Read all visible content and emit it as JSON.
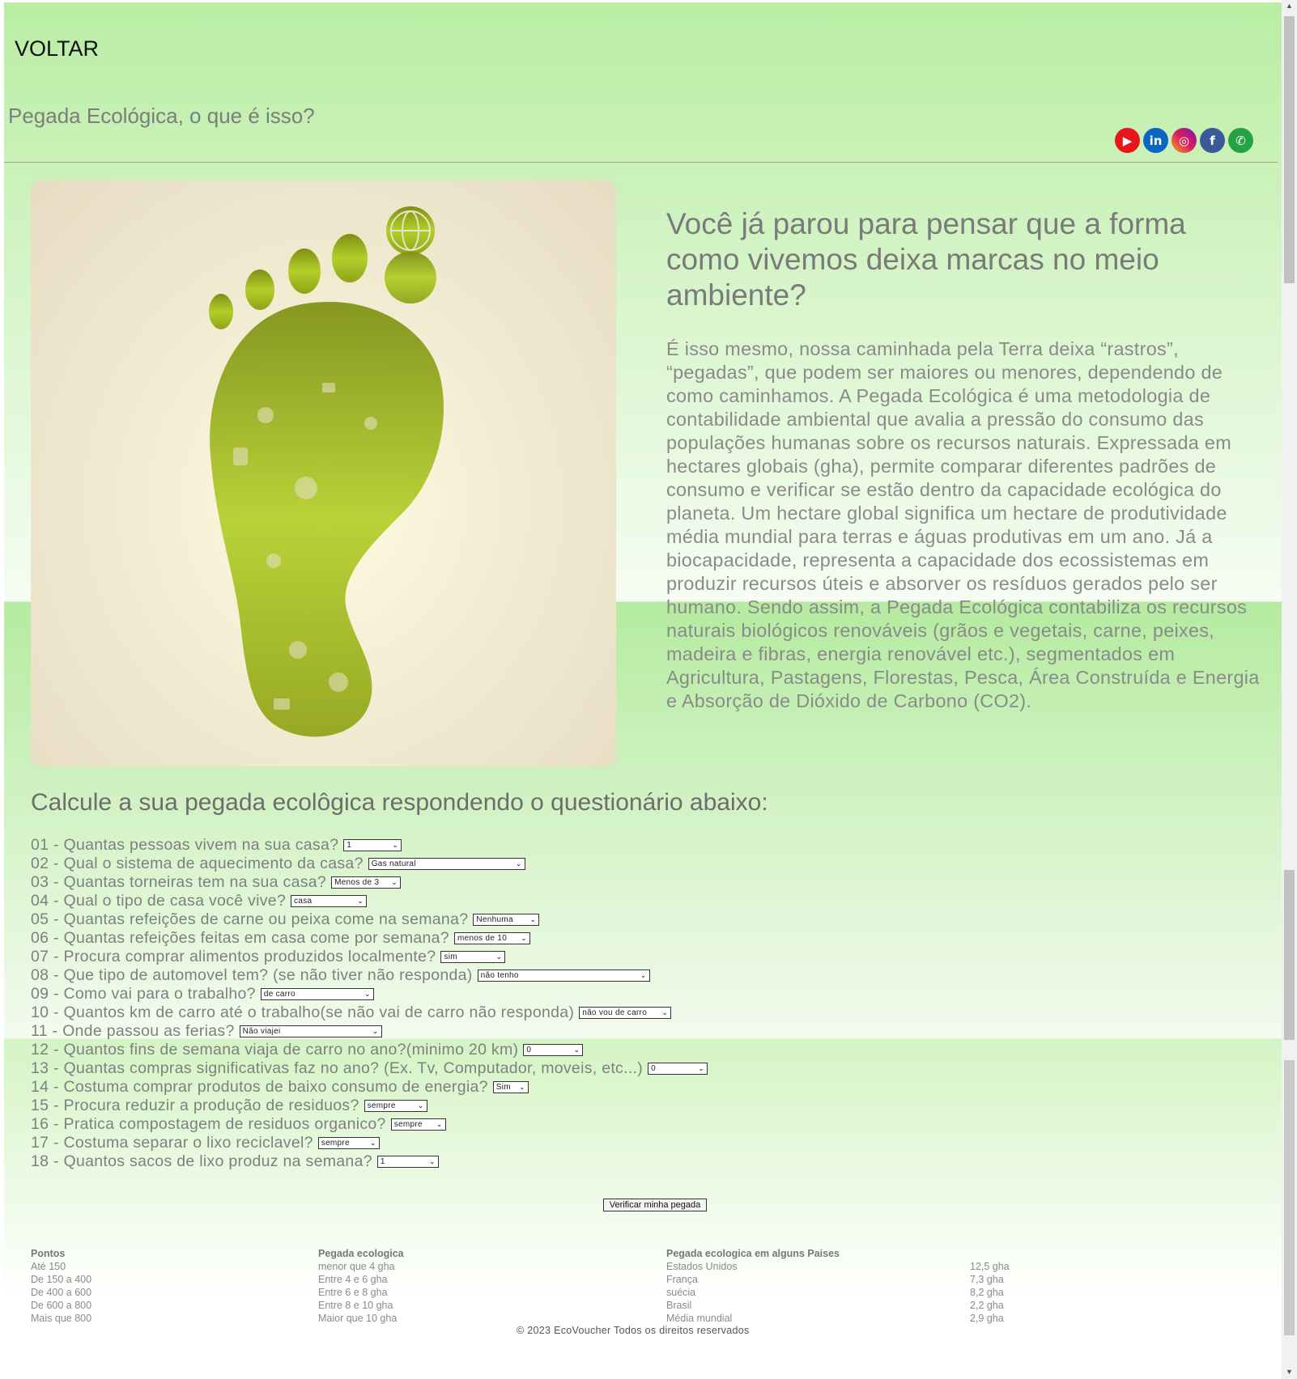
{
  "nav": {
    "back_label": "VOLTAR"
  },
  "header": {
    "title": "Pegada Ecológica, o que é isso?",
    "social": [
      {
        "name": "youtube-icon",
        "glyph": "▶"
      },
      {
        "name": "linkedin-icon",
        "glyph": "in"
      },
      {
        "name": "instagram-icon",
        "glyph": "◎"
      },
      {
        "name": "facebook-icon",
        "glyph": "f"
      },
      {
        "name": "whatsapp-icon",
        "glyph": "✆"
      }
    ]
  },
  "hero": {
    "heading": "Você já parou para pensar que a forma como vivemos deixa marcas no meio ambiente?",
    "text": "É isso mesmo, nossa caminhada pela Terra deixa “rastros”, “pegadas”, que podem ser maiores ou menores, dependendo de como caminhamos. A Pegada Ecológica é uma metodologia de contabilidade ambiental que avalia a pressão do consumo das populações humanas sobre os recursos naturais. Expressada em hectares globais (gha), permite comparar diferentes padrões de consumo e verificar se estão dentro da capacidade ecológica do planeta. Um hectare global significa um hectare de produtividade média mundial para terras e águas produtivas em um ano. Já a biocapacidade, representa a capacidade dos ecossistemas em produzir recursos úteis e absorver os resíduos gerados pelo ser humano. Sendo assim, a Pegada Ecológica contabiliza os recursos naturais biológicos renováveis (grãos e vegetais, carne, peixes, madeira e fibras, energia renovável etc.), segmentados em Agricultura, Pastagens, Florestas, Pesca, Área Construída e Energia e Absorção de Dióxido de Carbono (CO2)."
  },
  "quiz": {
    "heading": "Calcule a sua pegada ecolôgica respondendo o questionário abaixo:",
    "questions": [
      {
        "label": "01 - Quantas pessoas vivem na sua casa?",
        "value": "1",
        "w": 64
      },
      {
        "label": "02 - Qual o sistema de aquecimento da casa?",
        "value": "Gas natural",
        "w": 186
      },
      {
        "label": "03 - Quantas torneiras tem na sua casa?",
        "value": "Menos de 3",
        "w": 78
      },
      {
        "label": "04 - Qual o tipo de casa você vive?",
        "value": "casa",
        "w": 86
      },
      {
        "label": "05 - Quantas refeições de carne ou peixa come na semana?",
        "value": "Nenhuma",
        "w": 74
      },
      {
        "label": "06 - Quantas refeições feitas em casa come por semana?",
        "value": "menos de 10",
        "w": 86
      },
      {
        "label": "07 - Procura comprar alimentos produzidos localmente?",
        "value": "sim",
        "w": 72
      },
      {
        "label": "08 - Que tipo de automovel tem? (se não tiver não responda)",
        "value": "não tenho",
        "w": 205
      },
      {
        "label": "09 - Como vai para o trabalho?",
        "value": "de carro",
        "w": 132
      },
      {
        "label": "10 - Quantos km de carro até o trabalho(se não vai de carro não responda)",
        "value": "não vou de carro",
        "w": 106
      },
      {
        "label": "11 - Onde passou as ferias?",
        "value": "Não viajei",
        "w": 168
      },
      {
        "label": "12 - Quantos fins de semana viaja de carro no ano?(minimo 20 km)",
        "value": "0",
        "w": 66
      },
      {
        "label": "13 - Quantas compras significativas faz no ano? (Ex. Tv, Computador, moveis, etc...)",
        "value": "0",
        "w": 66
      },
      {
        "label": "14 - Costuma comprar produtos de baixo consumo de energia?",
        "value": "Sim",
        "w": 36
      },
      {
        "label": "15 - Procura reduzir a produção de residuos?",
        "value": "sempre",
        "w": 70
      },
      {
        "label": "16 - Pratica compostagem de residuos organico?",
        "value": "sempre",
        "w": 60
      },
      {
        "label": "17 - Costuma separar o lixo reciclavel?",
        "value": "sempre",
        "w": 68
      },
      {
        "label": "18 - Quantos sacos de lixo produz na semana?",
        "value": "1",
        "w": 68
      }
    ],
    "submit_label": "Verificar minha pegada"
  },
  "tables": {
    "points": {
      "header": "Pontos",
      "rows": [
        "Até 150",
        "De 150 a 400",
        "De 400 a 600",
        "De 600 a 800",
        "Mais que 800"
      ]
    },
    "footprint": {
      "header": "Pegada ecologica",
      "rows": [
        "menor que 4 gha",
        "Entre 4 e 6 gha",
        "Entre 6 e 8 gha",
        "Entre 8 e 10 gha",
        "Maior que 10 gha"
      ]
    },
    "countries": {
      "header": "Pegada ecologica em alguns Paises",
      "rows": [
        {
          "country": "Estados Unidos",
          "value": "12,5 gha"
        },
        {
          "country": "França",
          "value": "7,3 gha"
        },
        {
          "country": "suécia",
          "value": "8,2 gha"
        },
        {
          "country": "Brasil",
          "value": "2,2 gha"
        },
        {
          "country": "Média mundial",
          "value": "2,9 gha"
        }
      ]
    }
  },
  "footer": {
    "copyright": "© 2023 EcoVoucher Todos os direitos reservados"
  }
}
